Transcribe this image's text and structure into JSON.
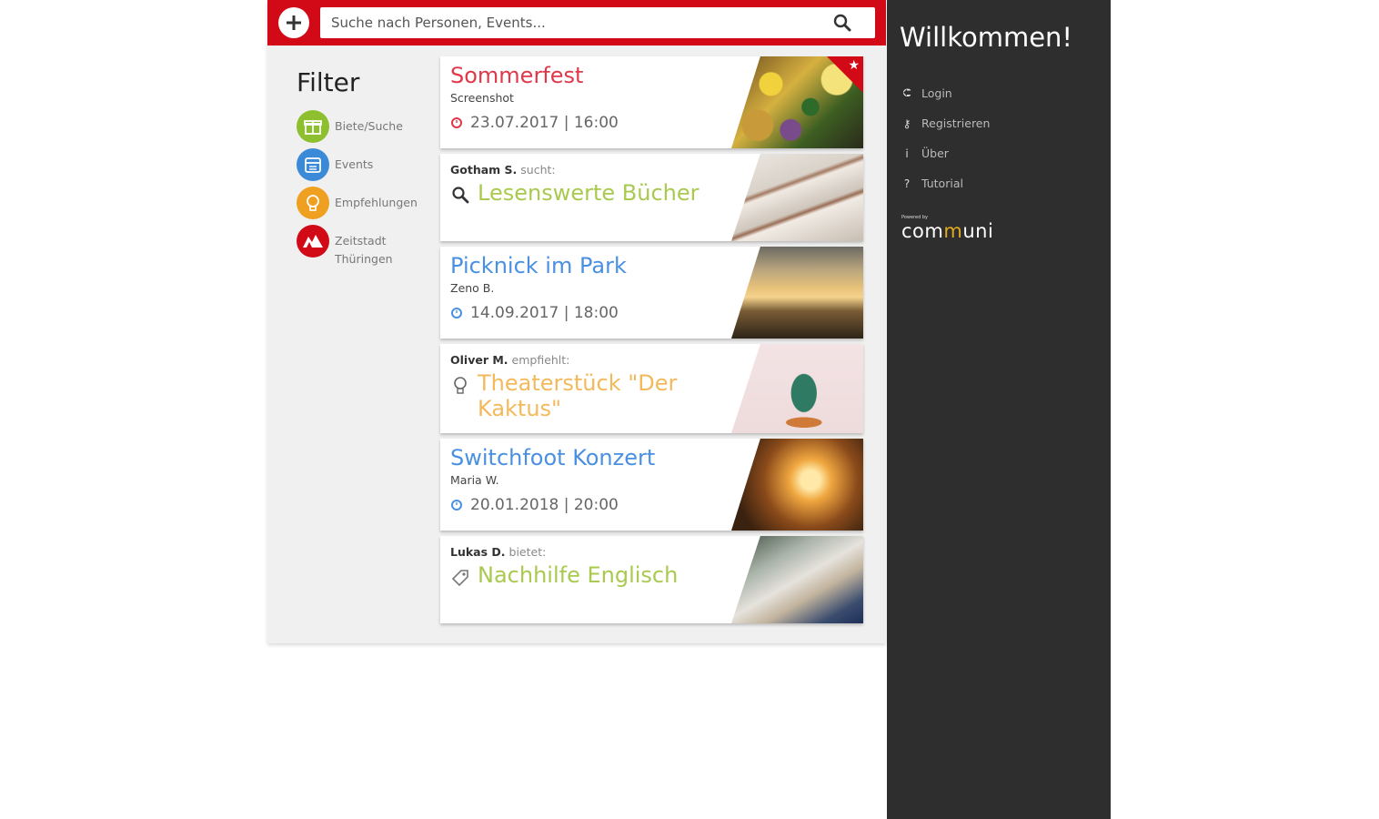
{
  "search": {
    "placeholder": "Suche nach Personen, Events..."
  },
  "filter": {
    "title": "Filter",
    "items": [
      {
        "label": "Biete/Suche",
        "icon": "gift-icon",
        "color": "#8dbf2f"
      },
      {
        "label": "Events",
        "icon": "calendar-icon",
        "color": "#3a8ad8"
      },
      {
        "label": "Empfehlungen",
        "icon": "lightbulb-icon",
        "color": "#f0a020"
      },
      {
        "label": "Zeitstadt Thüringen",
        "icon": "zeitstadt-logo-icon",
        "color": "#d20a17"
      }
    ]
  },
  "feed": {
    "events": [
      {
        "title": "Sommerfest",
        "author": "Screenshot",
        "date": "23.07.2017 | 16:00",
        "color": "#e0384a",
        "featured": true
      },
      {
        "title": "Picknick im Park",
        "author": "Zeno B.",
        "date": "14.09.2017 | 18:00",
        "color": "#4a90e2"
      },
      {
        "title": "Switchfoot Konzert",
        "author": "Maria W.",
        "date": "20.01.2018 | 20:00",
        "color": "#4a90e2"
      }
    ],
    "posts": [
      {
        "user": "Gotham S.",
        "action": "sucht:",
        "title": "Lesenswerte Bücher",
        "icon": "search-icon",
        "color": "#a9c94f"
      },
      {
        "user": "Oliver M.",
        "action": "empfiehlt:",
        "title": "Theaterstück \"Der Kaktus\"",
        "icon": "lightbulb-icon",
        "color": "#f3b95a"
      },
      {
        "user": "Lukas D.",
        "action": "bietet:",
        "title": "Nachhilfe Englisch",
        "icon": "tag-icon",
        "color": "#a9c94f"
      }
    ]
  },
  "sidebar": {
    "welcome": "Willkommen!",
    "menu": [
      {
        "label": "Login",
        "icon": "login-icon",
        "glyph": "⮈"
      },
      {
        "label": "Registrieren",
        "icon": "key-icon",
        "glyph": "⚷"
      },
      {
        "label": "Über",
        "icon": "info-icon",
        "glyph": "i"
      },
      {
        "label": "Tutorial",
        "icon": "question-icon",
        "glyph": "?"
      }
    ],
    "logo": {
      "text_before": "com",
      "text_accent": "m",
      "text_after": "uni",
      "small": "Powered by"
    }
  }
}
